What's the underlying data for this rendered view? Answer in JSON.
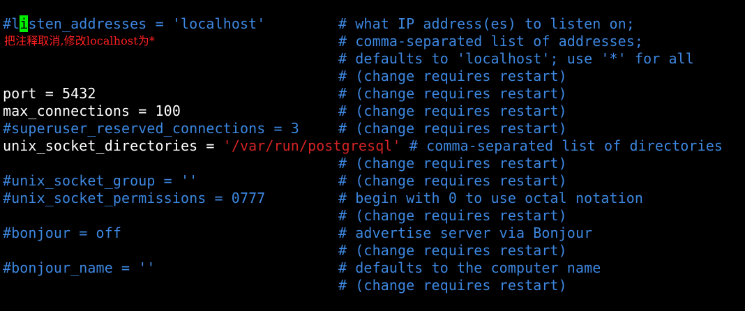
{
  "editor": {
    "lines": {
      "listen_prefix": "#l",
      "listen_cursor": "i",
      "listen_rest": "sten_addresses = 'localhost'",
      "port": "port = 5432",
      "max_connections": "max_connections = 100",
      "superuser": "#superuser_reserved_connections = 3",
      "unix_dirs_key": "unix_socket_directories = ",
      "unix_dirs_val": "'/var/run/postgresql'",
      "unix_dirs_comment": " # comma-separated list of directories",
      "unix_group": "#unix_socket_group = ''",
      "unix_perms": "#unix_socket_permissions = 0777",
      "bonjour": "#bonjour = off",
      "bonjour_name": "#bonjour_name = ''"
    },
    "annotation": "把注释取消,修改localhost为*",
    "comments": {
      "c1": "# what IP address(es) to listen on;",
      "c2": "# comma-separated list of addresses;",
      "c3": "# defaults to 'localhost'; use '*' for all",
      "c4": "# (change requires restart)",
      "c5": "# (change requires restart)",
      "c6": "# (change requires restart)",
      "c7": "# (change requires restart)",
      "c9": "# (change requires restart)",
      "c10": "# (change requires restart)",
      "c11": "# begin with 0 to use octal notation",
      "c12": "# (change requires restart)",
      "c13": "# advertise server via Bonjour",
      "c14": "# (change requires restart)",
      "c15": "# defaults to the computer name",
      "c16": "# (change requires restart)"
    },
    "colors": {
      "background": "#000000",
      "comment": "#3d87e0",
      "plain": "#ffffff",
      "string": "#d42323",
      "cursor": "#00ee00",
      "annotation": "#ff2020"
    }
  }
}
